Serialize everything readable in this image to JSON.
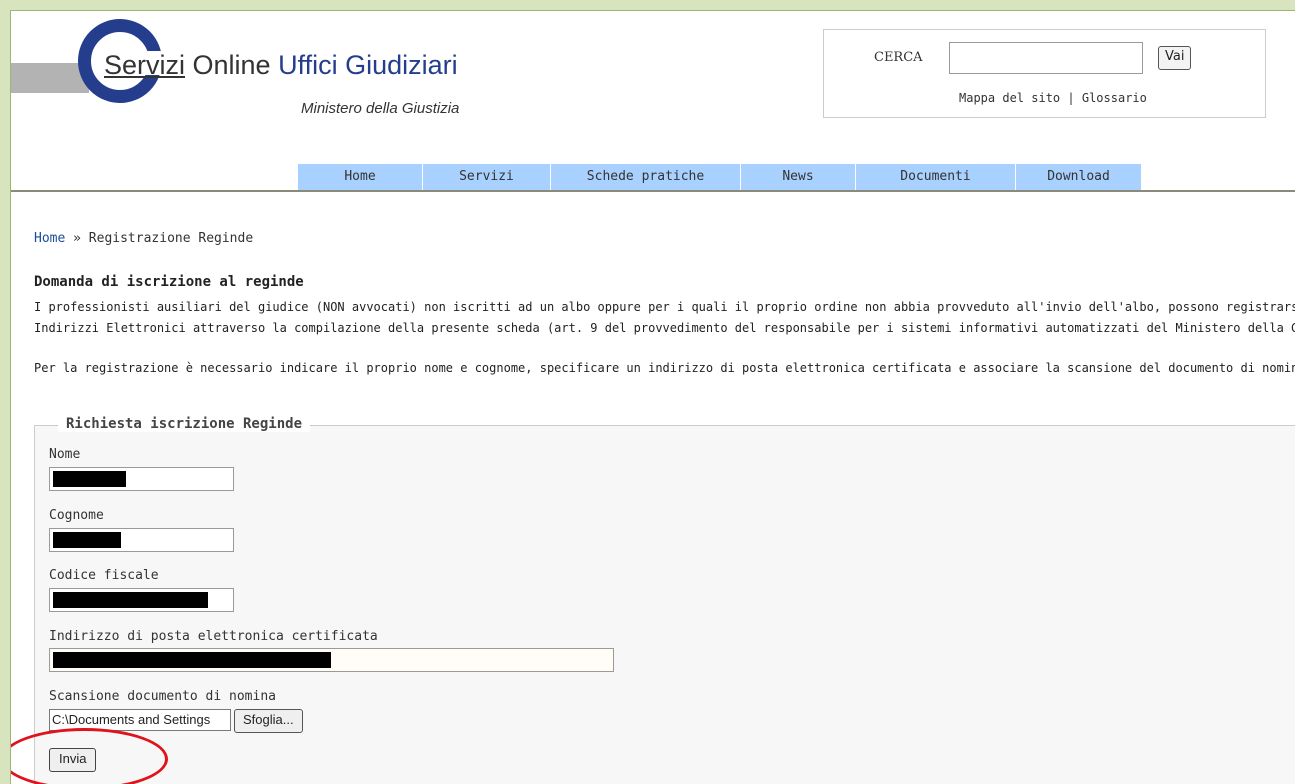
{
  "header": {
    "logo_first": "Servizi",
    "logo_second": " Online ",
    "logo_third": "Uffici Giudiziari",
    "logo_sub": "Ministero della Giustizia"
  },
  "search": {
    "label": "CERCA",
    "value": "",
    "button_label": "Vai",
    "link_sitemap": "Mappa del sito",
    "separator": "|",
    "link_glossary": "Glossario"
  },
  "nav": {
    "items": [
      {
        "label": "Home"
      },
      {
        "label": "Servizi"
      },
      {
        "label": "Schede pratiche"
      },
      {
        "label": "News"
      },
      {
        "label": "Documenti"
      },
      {
        "label": "Download"
      }
    ]
  },
  "breadcrumb": {
    "home": "Home",
    "separator": "»",
    "current": "Registrazione Reginde"
  },
  "content": {
    "title": "Domanda di iscrizione al reginde",
    "para1_line1": "I professionisti ausiliari del giudice (NON avvocati) non iscritti ad un albo oppure per i quali il proprio ordine non abbia provveduto all'invio dell'albo, possono registrarsi al Registro",
    "para1_line2": "Indirizzi Elettronici attraverso la compilazione della presente scheda (art. 9 del provvedimento del responsabile per i sistemi informativi automatizzati del Ministero della Giustizia",
    "para2": "Per la registrazione è necessario indicare il proprio nome e cognome, specificare un indirizzo di posta elettronica certificata e associare la scansione del documento di nomina (tast"
  },
  "form": {
    "legend": "Richiesta iscrizione Reginde",
    "fields": [
      {
        "label": "Nome",
        "value": ""
      },
      {
        "label": "Cognome",
        "value": ""
      },
      {
        "label": "Codice fiscale",
        "value": ""
      },
      {
        "label": "Indirizzo di posta elettronica certificata",
        "value": ""
      }
    ],
    "file_label": "Scansione documento di nomina",
    "file_value": "C:\\Documents and Settings",
    "browse_label": "Sfoglia...",
    "submit_label": "Invia"
  },
  "colors": {
    "outer_background": "#d7e4bd",
    "nav_background": "#a9d1ff",
    "logo_blue": "#243e8d",
    "highlight_circle": "#e0121b"
  }
}
